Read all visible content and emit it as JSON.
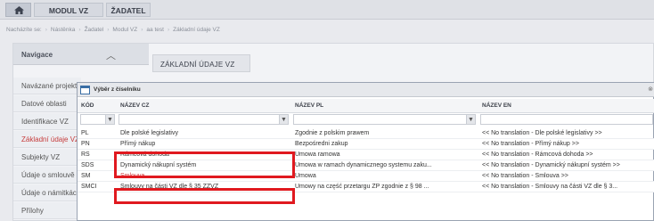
{
  "topbar": {
    "modul_vz": "MODUL VZ",
    "zadatel": "ŽADATEL"
  },
  "breadcrumb": {
    "prefix": "Nacházíte se:",
    "items": [
      "Nástěnka",
      "Žadatel",
      "Modul VZ",
      "aa test",
      "Základní údaje VZ"
    ]
  },
  "nav": {
    "title": "Navigace",
    "items": [
      "Navázané projekty",
      "Datové oblasti",
      "Identifikace VZ",
      "Základní údaje VZ",
      "Subjekty VZ",
      "Údaje o smlouvě",
      "Údaje o námitkách",
      "Přílohy"
    ]
  },
  "section": {
    "title": "ZÁKLADNÍ ÚDAJE VZ"
  },
  "dialog": {
    "title": "Výběr z číselníku",
    "columns": [
      "KÓD",
      "NÁZEV CZ",
      "NÁZEV PL",
      "NÁZEV EN"
    ],
    "rows": [
      [
        "PL",
        "Dle polské legislativy",
        "Zgodnie z polskim prawem",
        "<< No translation - Dle polské legislativy >>"
      ],
      [
        "PN",
        "Přímý nákup",
        "Bezpośredni zakup",
        "<< No translation - Přímý nákup >>"
      ],
      [
        "RS",
        "Rámcová dohoda",
        "Umowa ramowa",
        "<< No translation - Rámcová dohoda >>"
      ],
      [
        "SDS",
        "Dynamický nákupní systém",
        "Umowa w ramach dynamicznego systemu zaku...",
        "<< No translation - Dynamický nákupní systém >>"
      ],
      [
        "SM",
        "Smlouva",
        "Umowa",
        "<< No translation - Smlouva >>"
      ],
      [
        "SMCI",
        "Smlouvy na části VZ dle § 35 ZZVZ",
        "Umowy na część przetargu ZP zgodnie z § 98 ...",
        "<< No translation - Smlouvy na části VZ dle § 3..."
      ]
    ]
  },
  "colors": {
    "highlight": "#e0191f",
    "active_nav": "#c63c3c"
  }
}
